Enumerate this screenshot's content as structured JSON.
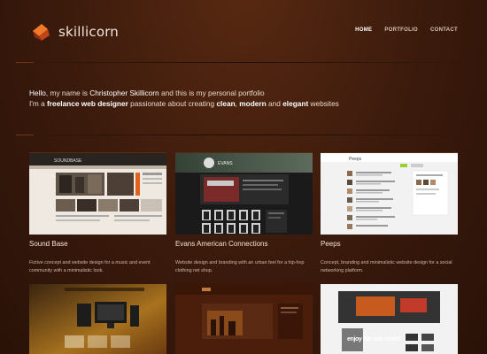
{
  "brand": {
    "name": "skillicorn"
  },
  "nav": {
    "items": [
      {
        "label": "HOME",
        "active": true
      },
      {
        "label": "PORTFOLIO",
        "active": false
      },
      {
        "label": "CONTACT",
        "active": false
      }
    ]
  },
  "intro": {
    "greeting_pre": "Hello",
    "greeting_mid": ", my name is ",
    "name": "Christopher Skillicorn",
    "greeting_post": " and this is my personal portfolio",
    "line2_a": "I'm a ",
    "line2_b": "freelance web designer",
    "line2_c": " passionate about creating ",
    "w_clean": "clean",
    "line2_d": ", ",
    "w_modern": "modern",
    "line2_e": " and ",
    "w_elegant": "elegant",
    "line2_f": " websites"
  },
  "projects": [
    {
      "title": "Sound Base",
      "desc": "Fictive concept and website design for a music and event community with a minimalistic look."
    },
    {
      "title": "Evans American Connections",
      "desc": "Website design and branding with an urban feel for a hip-hop clothing net shop."
    },
    {
      "title": "Peeps",
      "desc": "Concept, branding and minimalistic website design for a social networking platform."
    }
  ],
  "thumb_texts": {
    "sound": "SOUNDBASE",
    "peeps": "Peeps",
    "evans": "EVANS",
    "ride": "enjoy the ride more!"
  },
  "colors": {
    "background": "#3a1a0c",
    "accent_orange": "#e0621c",
    "text_light": "#e8d8cb"
  }
}
